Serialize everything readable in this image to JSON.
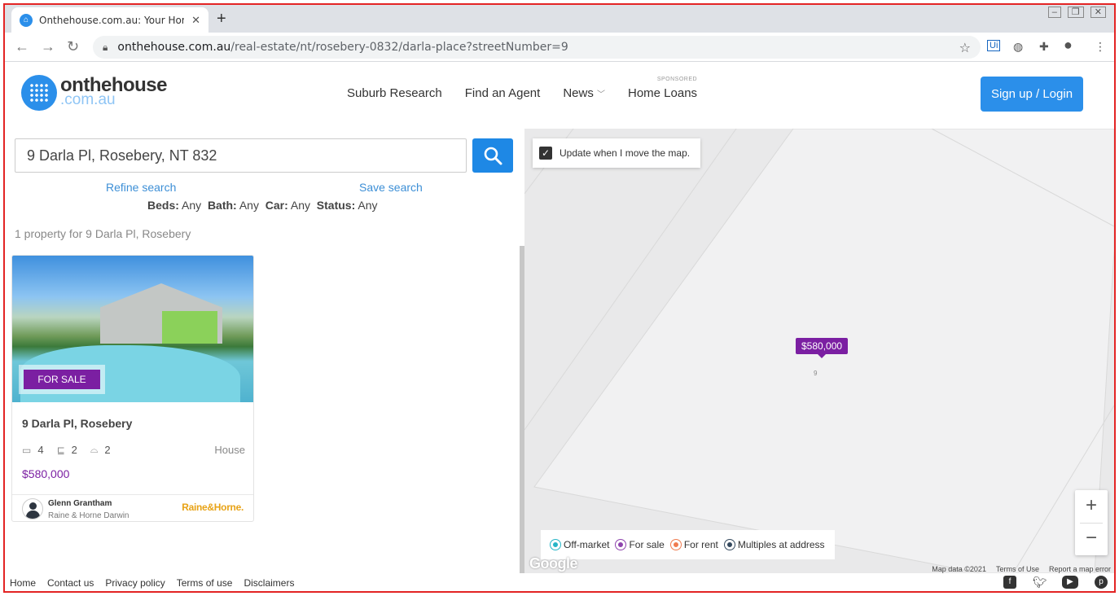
{
  "browser": {
    "tab_title": "Onthehouse.com.au: Your Home fo",
    "url_host": "onthehouse.com.au",
    "url_path": "/real-estate/nt/rosebery-0832/darla-place?streetNumber=9"
  },
  "header": {
    "logo_line1": "onthehouse",
    "logo_line2": ".com.au",
    "nav": {
      "suburb": "Suburb Research",
      "agent": "Find an Agent",
      "news": "News",
      "homeloans": "Home Loans",
      "sponsored": "SPONSORED"
    },
    "signup_label": "Sign up / Login"
  },
  "search": {
    "query": "9 Darla Pl, Rosebery, NT 832",
    "refine": "Refine search",
    "save": "Save search",
    "filters": {
      "beds_label": "Beds:",
      "beds": "Any",
      "bath_label": "Bath:",
      "bath": "Any",
      "car_label": "Car:",
      "car": "Any",
      "status_label": "Status:",
      "status": "Any"
    },
    "result_count": "1 property for 9 Darla Pl, Rosebery"
  },
  "listing": {
    "badge": "FOR SALE",
    "address": "9 Darla Pl, Rosebery",
    "beds": "4",
    "baths": "2",
    "cars": "2",
    "type": "House",
    "price": "$580,000",
    "agent_name": "Glenn Grantham",
    "agency": "Raine & Horne Darwin",
    "brand": "Raine&Horne."
  },
  "map": {
    "update_label": "Update when I move the map.",
    "pin_price": "$580,000",
    "street_number": "9",
    "legend": {
      "offmarket": "Off-market",
      "forsale": "For sale",
      "forrent": "For rent",
      "multiples": "Multiples at address"
    },
    "google": "Google",
    "attrib": {
      "mapdata": "Map data ©2021",
      "terms": "Terms of Use",
      "report": "Report a map error"
    },
    "colors": {
      "offmarket": "#26b5c7",
      "forsale": "#8e44ad",
      "forrent": "#f07b4f",
      "multiples": "#34495e"
    }
  },
  "footer": {
    "home": "Home",
    "contact": "Contact us",
    "privacy": "Privacy policy",
    "terms": "Terms of use",
    "disclaimers": "Disclaimers",
    "social_icons": [
      "facebook-icon",
      "twitter-icon",
      "youtube-icon",
      "pinterest-icon"
    ]
  }
}
